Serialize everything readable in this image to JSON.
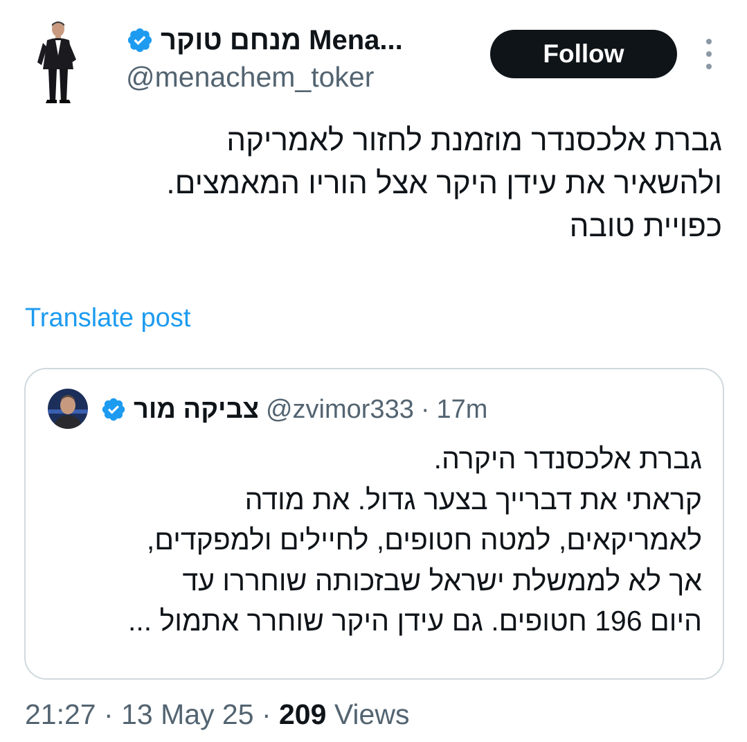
{
  "author": {
    "name": "מנחם טוקר Mena...",
    "handle": "@menachem_toker",
    "verified": true
  },
  "follow_label": "Follow",
  "tweet": {
    "text": "גברת אלכסנדר מוזמנת לחזור לאמריקה\nולהשאיר את עידן היקר אצל הוריו המאמצים.\nכפויית טובה"
  },
  "translate_label": "Translate post",
  "quoted": {
    "name": "צביקה מור",
    "handle": "@zvimor333",
    "separator": "·",
    "time": "17m",
    "text": "גברת אלכסנדר היקרה.\nקראתי את דברייך בצער גדול. את מודה\nלאמריקאים, למטה חטופים, לחיילים ולמפקדים,\nאך לא לממשלת ישראל שבזכותה שוחררו עד\nהיום 196 חטופים. גם עידן היקר שוחרר אתמול ..."
  },
  "meta": {
    "time": "21:27",
    "sep1": "·",
    "date": "13 May 25",
    "sep2": "·",
    "views_count": "209",
    "views_label": "Views"
  },
  "colors": {
    "verified_blue": "#1d9bf0",
    "text_primary": "#0f1419",
    "text_secondary": "#536471",
    "link_blue": "#1d9bf0",
    "button_bg": "#0f1419",
    "border": "#cfd9de"
  },
  "icons": {
    "verified": "verified-badge-icon",
    "more": "more-vertical-icon"
  }
}
